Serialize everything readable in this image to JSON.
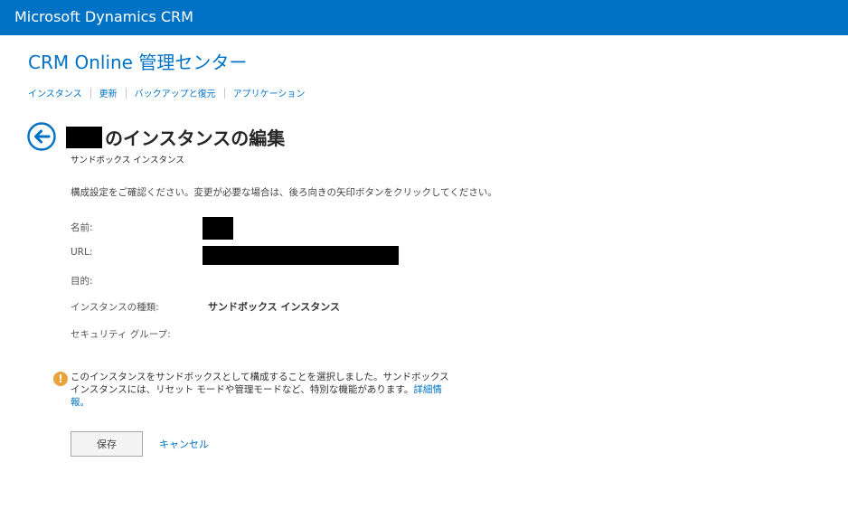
{
  "app": {
    "title": "Microsoft Dynamics CRM"
  },
  "page": {
    "title": "CRM Online 管理センター"
  },
  "nav": {
    "items": [
      {
        "label": "インスタンス"
      },
      {
        "label": "更新"
      },
      {
        "label": "バックアップと復元"
      },
      {
        "label": "アプリケーション"
      }
    ]
  },
  "heading": {
    "suffix": "のインスタンスの編集",
    "subheading": "サンドボックス インスタンス"
  },
  "instruction": "構成設定をご確認ください。変更が必要な場合は、後ろ向きの矢印ボタンをクリックしてください。",
  "fields": {
    "name_label": "名前:",
    "url_label": "URL:",
    "purpose_label": "目的:",
    "instance_type_label": "インスタンスの種類:",
    "instance_type_value": "サンドボックス インスタンス",
    "security_group_label": "セキュリティ グループ:"
  },
  "warning": {
    "text": "このインスタンスをサンドボックスとして構成することを選択しました。サンドボックス インスタンスには、リセット モードや管理モードなど、特別な機能があります。",
    "link": "詳細情報。"
  },
  "buttons": {
    "save": "保存",
    "cancel": "キャンセル"
  },
  "colors": {
    "brand": "#0072c6",
    "warning": "#e8a33d"
  },
  "icons": {
    "back": "back-arrow-circle-icon",
    "warning": "exclamation-circle-icon"
  }
}
